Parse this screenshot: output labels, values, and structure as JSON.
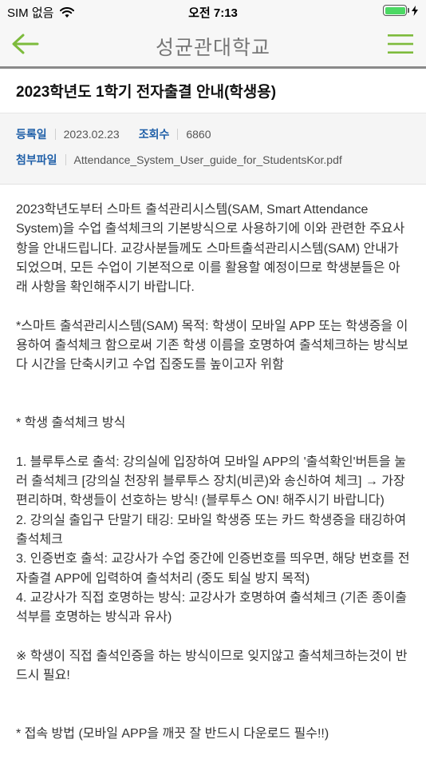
{
  "status_bar": {
    "carrier": "SIM 없음",
    "time": "오전 7:13"
  },
  "nav": {
    "title": "성균관대학교"
  },
  "article": {
    "title": "2023학년도 1학기 전자출결 안내(학생용)",
    "meta": {
      "date_label": "등록일",
      "date_value": "2023.02.23",
      "views_label": "조회수",
      "views_value": "6860",
      "attachment_label": "첨부파일",
      "attachment_value": "Attendance_System_User_guide_for_StudentsKor.pdf"
    },
    "body": {
      "intro": "2023학년도부터 스마트 출석관리시스템(SAM, Smart Attendance System)을 수업 출석체크의 기본방식으로 사용하기에 이와 관련한 주요사항을 안내드립니다. 교강사분들께도 스마트출석관리시스템(SAM) 안내가 되었으며, 모든 수업이 기본적으로 이를 활용할 예정이므로 학생분들은 아래 사항을 확인해주시기 바랍니다.",
      "purpose": "*스마트 출석관리시스템(SAM) 목적: 학생이 모바일 APP 또는 학생증을 이용하여 출석체크 함으로써 기존 학생 이름을 호명하여 출석체크하는 방식보다 시간을 단축시키고 수업 집중도를 높이고자 위함",
      "methods_heading": "* 학생 출석체크 방식",
      "method1": "1. 블루투스로 출석: 강의실에 입장하여 모바일 APP의 '출석확인'버튼을 눌러 출석체크 [강의실 천장위 블루투스 장치(비콘)와 송신하여 체크] → 가장 편리하며, 학생들이 선호하는 방식! (블루투스 ON! 해주시기 바랍니다)",
      "method2": "2. 강의실 출입구 단말기 태깅: 모바일 학생증 또는 카드 학생증을 태깅하여 출석체크",
      "method3": "3. 인증번호 출석: 교강사가 수업 중간에 인증번호를 띄우면, 해당 번호를 전자출결 APP에 입력하여 출석처리 (중도 퇴실 방지 목적)",
      "method4": "4. 교강사가 직접 호명하는 방식: 교강사가 호명하여 출석체크 (기존 종이출석부를 호명하는 방식과 유사)",
      "notice": "※ 학생이 직접 출석인증을 하는 방식이므로 잊지않고 출석체크하는것이 반드시 필요!",
      "next_heading_partial": "* 접속 방법 (모바일 APP을 깨끗 잘 반드시 다운로드 필수!!)"
    }
  },
  "colors": {
    "accent_green": "#7dbb3c",
    "label_blue": "#1f5fa8",
    "battery_green": "#4cd964"
  }
}
